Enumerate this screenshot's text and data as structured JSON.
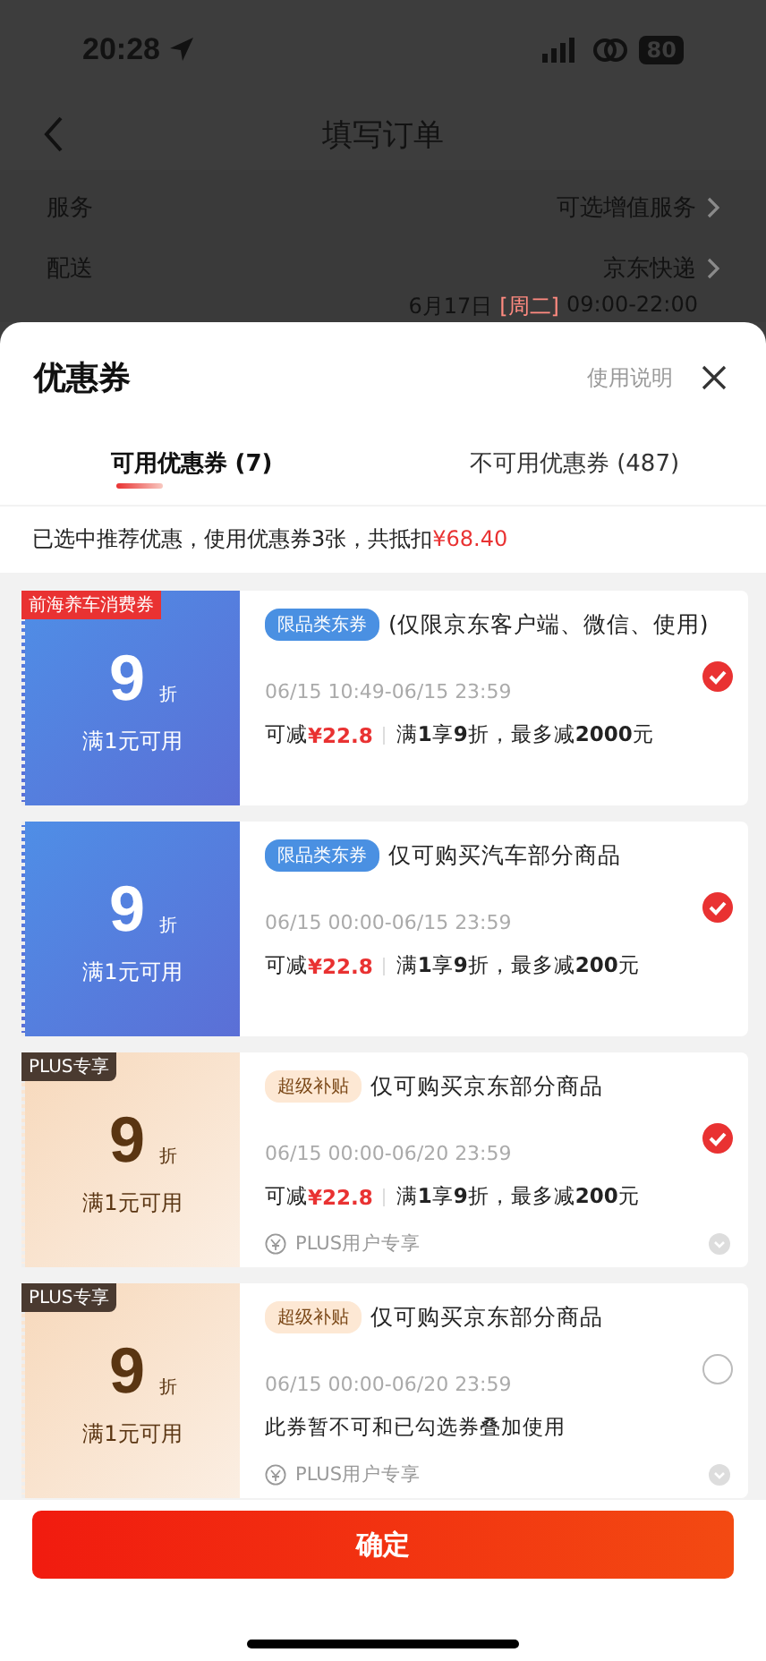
{
  "status_bar": {
    "time": "20:28",
    "battery": "80"
  },
  "nav": {
    "title": "填写订单"
  },
  "order_rows": [
    {
      "label": "服务",
      "value": "可选增值服务"
    },
    {
      "label": "配送",
      "value": "京东快递"
    }
  ],
  "delivery_time": {
    "date": "6月17日",
    "weekday": "[周二]",
    "time": "09:00-22:00"
  },
  "sheet": {
    "title": "优惠券",
    "help_link": "使用说明"
  },
  "tabs": [
    {
      "label": "可用优惠券 (7)",
      "selected": true
    },
    {
      "label": "不可用优惠券 (487)",
      "selected": false
    }
  ],
  "summary": {
    "text": "已选中推荐优惠，使用优惠券3张，共抵扣",
    "amount": "¥68.40"
  },
  "coupons": [
    {
      "kind": "blue",
      "badge": "前海养车消费券",
      "discount": "9",
      "unit": "折",
      "threshold": "满1元可用",
      "tag": "限品类东券",
      "title": "(仅限京东客户端、微信、使用)",
      "validity": "06/15 10:49-06/15 23:59",
      "saving_label": "可减",
      "saving": "¥22.8",
      "rule": "满**1**享**9**折，最多减**2000**元",
      "checked": true
    },
    {
      "kind": "blue",
      "discount": "9",
      "unit": "折",
      "threshold": "满1元可用",
      "tag": "限品类东券",
      "title": "仅可购买汽车部分商品",
      "validity": "06/15 00:00-06/15 23:59",
      "saving_label": "可减",
      "saving": "¥22.8",
      "rule": "满**1**享**9**折，最多减**200**元",
      "checked": true
    },
    {
      "kind": "plus",
      "badge": "PLUS专享",
      "discount": "9",
      "unit": "折",
      "threshold": "满1元可用",
      "tag": "超级补贴",
      "title": "仅可购买京东部分商品",
      "validity": "06/15 00:00-06/20 23:59",
      "saving_label": "可减",
      "saving": "¥22.8",
      "rule": "满**1**享**9**折，最多减**200**元",
      "footer": "PLUS用户专享",
      "checked": true
    },
    {
      "kind": "plus",
      "badge": "PLUS专享",
      "discount": "9",
      "unit": "折",
      "threshold": "满1元可用",
      "tag": "超级补贴",
      "title": "仅可购买京东部分商品",
      "validity": "06/15 00:00-06/20 23:59",
      "note": "此券暂不可和已勾选券叠加使用",
      "footer": "PLUS用户专享",
      "checked": false
    }
  ],
  "confirm_button": "确定"
}
